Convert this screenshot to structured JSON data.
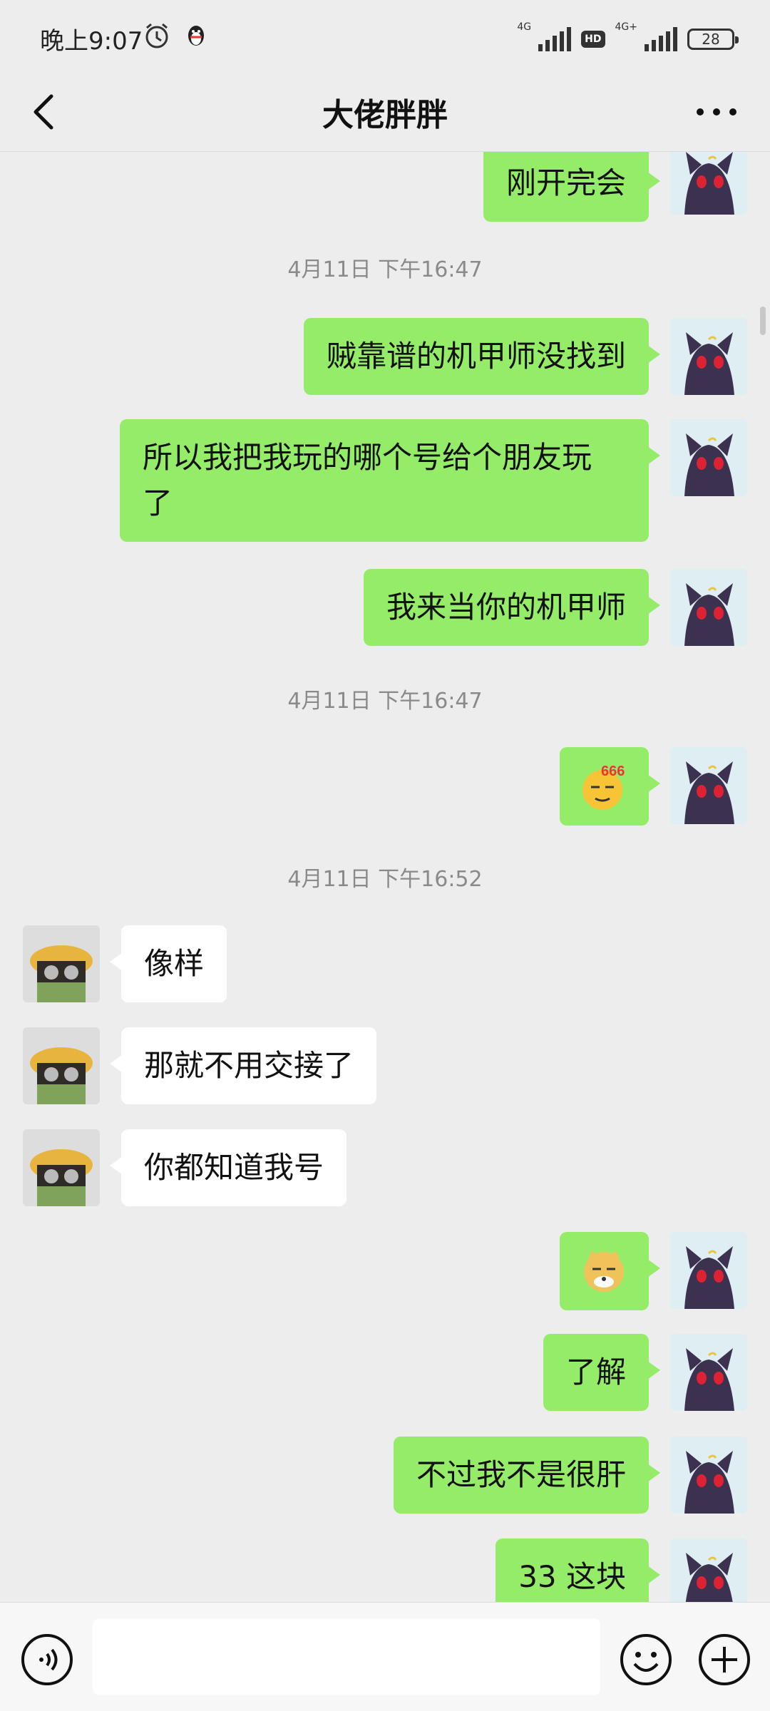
{
  "status_bar": {
    "time": "晚上9:07",
    "network_a": "4G",
    "hd": "HD",
    "network_b": "4G+",
    "battery": "28"
  },
  "header": {
    "title": "大佬胖胖"
  },
  "messages": [
    {
      "kind": "me",
      "text": "刚开完会"
    },
    {
      "kind": "time",
      "text": "4月11日 下午16:47"
    },
    {
      "kind": "me",
      "text": "贼靠谱的机甲师没找到"
    },
    {
      "kind": "me",
      "text_line1": "所以我把我玩的哪个号给个朋友玩",
      "text_line2": "了"
    },
    {
      "kind": "me",
      "text": "我来当你的机甲师"
    },
    {
      "kind": "time",
      "text": "4月11日 下午16:47"
    },
    {
      "kind": "me",
      "sticker": "666-emoji",
      "sticker_text": "666"
    },
    {
      "kind": "time",
      "text": "4月11日 下午16:52"
    },
    {
      "kind": "other",
      "text": "像样"
    },
    {
      "kind": "other",
      "text": "那就不用交接了"
    },
    {
      "kind": "other",
      "text": "你都知道我号"
    },
    {
      "kind": "me",
      "sticker": "doge-emoji"
    },
    {
      "kind": "me",
      "text": "了解"
    },
    {
      "kind": "me",
      "text": "不过我不是很肝"
    },
    {
      "kind": "me",
      "text": "33 这块"
    }
  ],
  "colors": {
    "my_bubble": "#95ec69",
    "other_bubble": "#ffffff",
    "background": "#ededed"
  },
  "icons": {
    "back": "chevron-left-icon",
    "more": "more-dots-icon",
    "voice": "voice-icon",
    "emoji": "emoji-icon",
    "plus": "plus-icon"
  }
}
